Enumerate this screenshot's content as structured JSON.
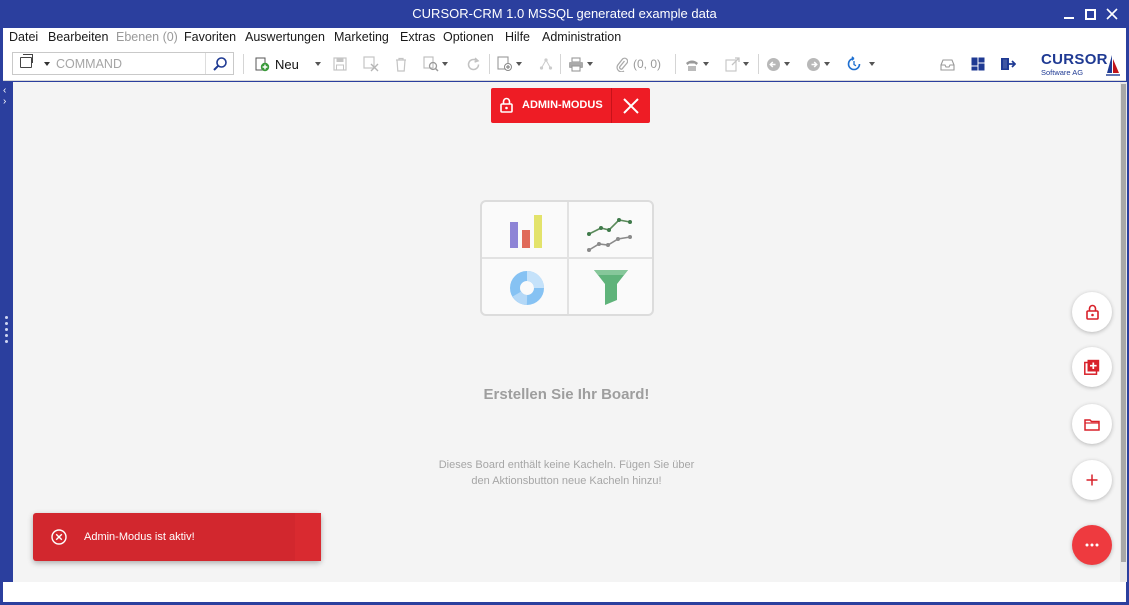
{
  "window": {
    "title": "CURSOR-CRM 1.0 MSSQL generated example data",
    "controls": [
      "minimize",
      "maximize",
      "close"
    ]
  },
  "menu": {
    "items": [
      {
        "label": "Datei",
        "enabled": true
      },
      {
        "label": "Bearbeiten",
        "enabled": true
      },
      {
        "label": "Ebenen (0)",
        "enabled": false
      },
      {
        "label": "Favoriten",
        "enabled": true
      },
      {
        "label": "Auswertungen",
        "enabled": true
      },
      {
        "label": "Marketing",
        "enabled": true
      },
      {
        "label": "Extras",
        "enabled": true
      },
      {
        "label": "Optionen",
        "enabled": true
      },
      {
        "label": "Hilfe",
        "enabled": true
      },
      {
        "label": "Administration",
        "enabled": true
      }
    ]
  },
  "toolbar": {
    "command_placeholder": "COMMAND",
    "new_label": "Neu",
    "coords_label": "(0, 0)"
  },
  "logo": {
    "name": "CURSOR",
    "sub": "Software AG"
  },
  "admin_badge": {
    "label": "ADMIN-MODUS"
  },
  "board": {
    "title": "Erstellen Sie Ihr Board!",
    "desc_line1": "Dieses Board enthält keine Kacheln. Fügen Sie über",
    "desc_line2": "den Aktionsbutton neue Kacheln hinzu!"
  },
  "fabs": [
    "lock-icon",
    "add-tile-icon",
    "folder-icon",
    "plus-icon",
    "more-icon"
  ],
  "toast": {
    "message": "Admin-Modus ist aktiv!"
  },
  "colors": {
    "brand_blue": "#2b3f9e",
    "admin_red": "#ee1c25",
    "toast_red": "#d2272e"
  }
}
